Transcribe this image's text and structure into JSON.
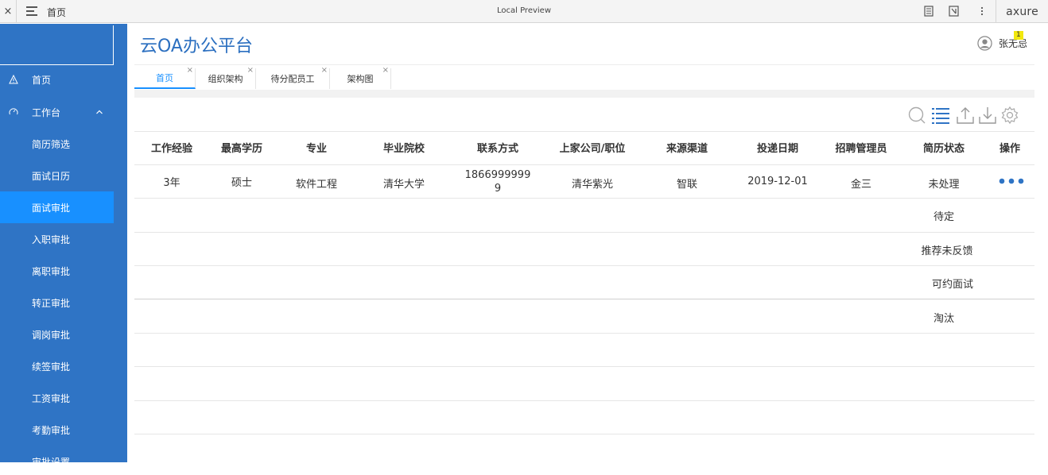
{
  "preview_bar": {
    "close": "×",
    "page_name": "首页",
    "title": "Local Preview",
    "logo": "axure"
  },
  "sidebar": {
    "items": [
      {
        "label": "首页",
        "icon": "warning-icon"
      },
      {
        "label": "工作台",
        "icon": "dashboard-icon"
      },
      {
        "label": "简历筛选"
      },
      {
        "label": "面试日历"
      },
      {
        "label": "面试审批"
      },
      {
        "label": "入职审批"
      },
      {
        "label": "离职审批"
      },
      {
        "label": "转正审批"
      },
      {
        "label": "调岗审批"
      },
      {
        "label": "续签审批"
      },
      {
        "label": "工资审批"
      },
      {
        "label": "考勤审批"
      },
      {
        "label": "审批设置"
      }
    ],
    "active_index": 4
  },
  "header": {
    "app_title": "云OA办公平台",
    "user_name": "张无忌",
    "notification_count": "1"
  },
  "tabs": [
    {
      "label": "首页"
    },
    {
      "label": "组织架构"
    },
    {
      "label": "待分配员工"
    },
    {
      "label": "架构图"
    }
  ],
  "tab_close": "×",
  "table": {
    "columns": [
      "工作经验",
      "最高学历",
      "专业",
      "毕业院校",
      "联系方式",
      "上家公司/职位",
      "来源渠道",
      "投递日期",
      "招聘管理员",
      "简历状态",
      "操作"
    ],
    "row": {
      "experience": "3年",
      "education": "硕士",
      "major": "软件工程",
      "school": "清华大学",
      "phone_line1": "1866999999",
      "phone_line2": "9",
      "prev_company": "清华紫光",
      "source": "智联",
      "date": "2019-12-01",
      "recruiter": "金三",
      "status": "未处理"
    },
    "status_options": [
      "待定",
      "推荐未反馈",
      "可约面试",
      "淘汰"
    ]
  },
  "colors": {
    "sidebar": "#2f74c5",
    "active": "#1890ff",
    "title": "#2b6fc0"
  }
}
